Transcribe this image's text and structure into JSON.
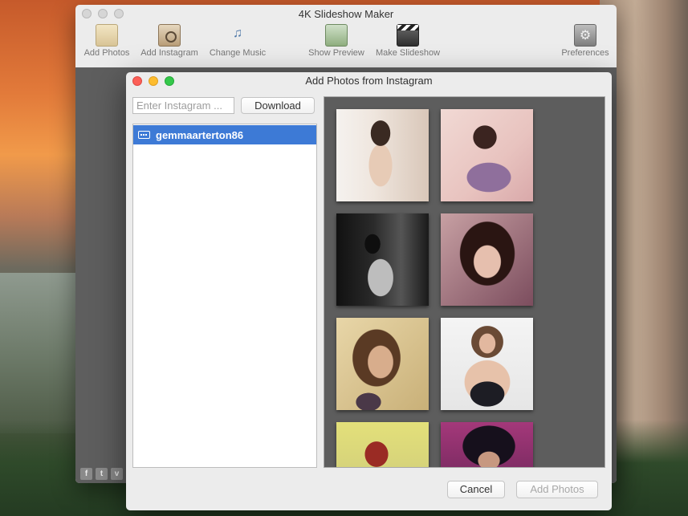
{
  "main_window": {
    "title": "4K Slideshow Maker",
    "toolbar": [
      {
        "label": "Add Photos",
        "icon": "add-photos-icon"
      },
      {
        "label": "Add Instagram",
        "icon": "instagram-icon"
      },
      {
        "label": "Change Music",
        "icon": "music-icon"
      },
      {
        "label": "Show Preview",
        "icon": "preview-icon"
      },
      {
        "label": "Make Slideshow",
        "icon": "clapperboard-icon"
      },
      {
        "label": "Preferences",
        "icon": "preferences-icon"
      }
    ],
    "social": [
      "f",
      "t",
      "v"
    ]
  },
  "dialog": {
    "title": "Add Photos from Instagram",
    "search": {
      "placeholder": "Enter Instagram ...",
      "value": ""
    },
    "download_label": "Download",
    "accounts": [
      {
        "name": "gemmaarterton86",
        "selected": true
      }
    ],
    "cancel_label": "Cancel",
    "add_label": "Add Photos"
  }
}
